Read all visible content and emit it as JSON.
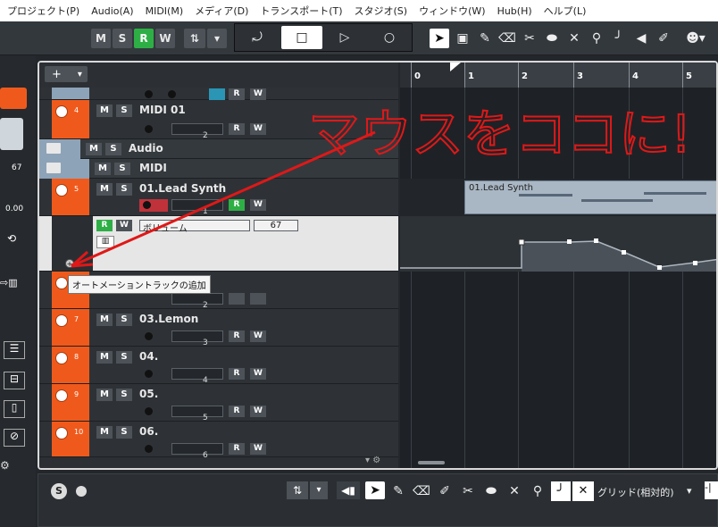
{
  "menu": [
    "プロジェクト(P)",
    "Audio(A)",
    "MIDI(M)",
    "メディア(D)",
    "トランスポート(T)",
    "スタジオ(S)",
    "ウィンドウ(W)",
    "Hub(H)",
    "ヘルプ(L)"
  ],
  "toolbar": {
    "m": "M",
    "s": "S",
    "r": "R",
    "w": "W"
  },
  "tracklist": {
    "add": "+",
    "dropdown": "▾"
  },
  "tracks": [
    {
      "num": "4",
      "name": "MIDI 01",
      "ch": "2",
      "r": "R",
      "w": "W",
      "m": "M",
      "s": "S"
    },
    {
      "num": "",
      "name": "Audio",
      "m": "M",
      "s": "S",
      "folder": true
    },
    {
      "num": "",
      "name": "MIDI",
      "m": "M",
      "s": "S",
      "folder": true
    },
    {
      "num": "5",
      "name": "01.Lead Synth",
      "ch": "1",
      "r": "R",
      "w": "W",
      "m": "M",
      "s": "S"
    },
    {
      "num": "7",
      "name": "03.Lemon",
      "ch": "3",
      "r": "R",
      "w": "W",
      "m": "M",
      "s": "S"
    },
    {
      "num": "8",
      "name": "04.",
      "ch": "4",
      "r": "R",
      "w": "W",
      "m": "M",
      "s": "S"
    },
    {
      "num": "9",
      "name": "05.",
      "ch": "5",
      "r": "R",
      "w": "W",
      "m": "M",
      "s": "S"
    },
    {
      "num": "10",
      "name": "06.",
      "ch": "6",
      "r": "R",
      "w": "W",
      "m": "M",
      "s": "S"
    }
  ],
  "automation": {
    "r": "R",
    "w": "W",
    "param": "ボリューム",
    "value": "67"
  },
  "tooltip": "オートメーショントラックの追加",
  "left_values": {
    "v1": "67",
    "v2": "0.00"
  },
  "ruler": [
    "0",
    "1",
    "2",
    "3",
    "4",
    "5"
  ],
  "part_name": "01.Lead Synth",
  "handwriting": "マウスをココに!",
  "bottom": {
    "grid": "グリッド(相対的)",
    "s": "S"
  }
}
